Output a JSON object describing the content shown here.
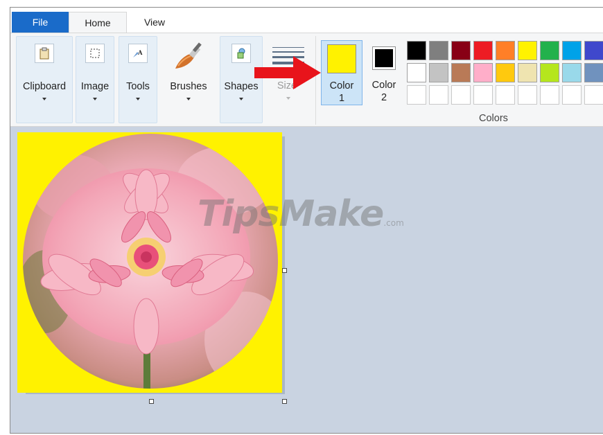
{
  "tabs": {
    "file": "File",
    "home": "Home",
    "view": "View"
  },
  "groups": {
    "clipboard": "Clipboard",
    "image": "Image",
    "tools": "Tools",
    "brushes": "Brushes",
    "shapes": "Shapes",
    "size": "Size"
  },
  "color1": {
    "line1": "Color",
    "line2": "1",
    "value": "#FFF200"
  },
  "color2": {
    "line1": "Color",
    "line2": "2",
    "value": "#000000"
  },
  "palette": {
    "label": "Colors",
    "row1": [
      "#000000",
      "#7F7F7F",
      "#880015",
      "#ED1C24",
      "#FF7F27",
      "#FFF200",
      "#22B14C",
      "#00A2E8",
      "#3F48CC"
    ],
    "row2": [
      "#FFFFFF",
      "#C3C3C3",
      "#B97A57",
      "#FFAEC9",
      "#FFC90E",
      "#EFE4B0",
      "#B5E61D",
      "#99D9EA",
      "#7092BE"
    ],
    "row3_empty_count": 9
  },
  "annotation": {
    "arrow_color": "#E8141B"
  },
  "watermark": {
    "main": "TipsMake",
    "suffix": ".com"
  },
  "canvas": {
    "background_color": "#FFF200",
    "content": "pink dahlia flower in circular crop"
  }
}
